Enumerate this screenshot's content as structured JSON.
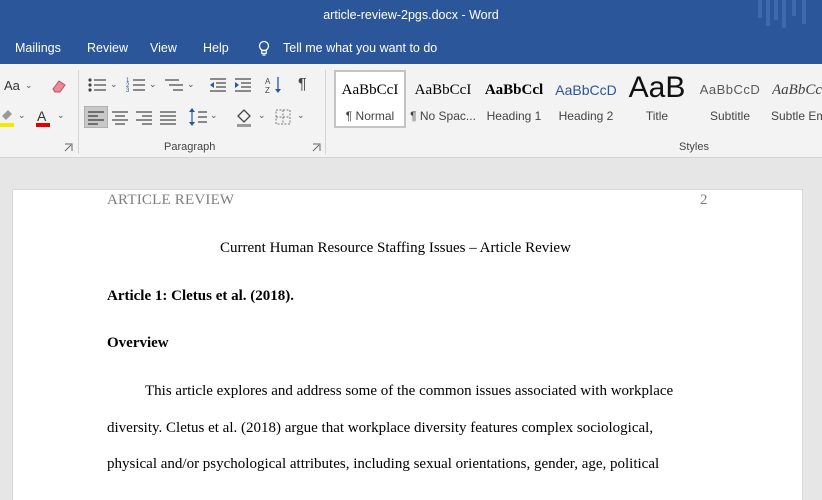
{
  "window": {
    "title": "article-review-2pgs.docx  -  Word"
  },
  "menu": {
    "items": [
      "Mailings",
      "Review",
      "View",
      "Help"
    ],
    "tell_me": "Tell me what you want to do"
  },
  "ribbon": {
    "font_group": {
      "change_case": "Aa"
    },
    "paragraph_group": {
      "label": "Paragraph"
    },
    "styles_group": {
      "label": "Styles",
      "styles": [
        {
          "sample": "AaBbCcI",
          "name": "¶ Normal"
        },
        {
          "sample": "AaBbCcI",
          "name": "¶ No Spac..."
        },
        {
          "sample": "AaBbCcl",
          "name": "Heading 1"
        },
        {
          "sample": "AaBbCcD",
          "name": "Heading 2"
        },
        {
          "sample": "AaB",
          "name": "Title"
        },
        {
          "sample": "AaBbCcD",
          "name": "Subtitle"
        },
        {
          "sample": "AaBbCc",
          "name": "Subtle Em"
        }
      ]
    }
  },
  "document": {
    "header_left": "ARTICLE REVIEW",
    "header_page": "2",
    "title": "Current Human Resource Staffing Issues – Article Review",
    "heading1": "Article 1: Cletus et al. (2018).",
    "heading2": "Overview",
    "body_lines": [
      "This article explores and address some of the common issues associated with workplace",
      "diversity. Cletus et al. (2018) argue that workplace diversity features complex sociological,",
      "physical and/or psychological attributes, including sexual orientations, gender, age, political"
    ]
  },
  "colors": {
    "brand": "#2b579a",
    "ribbon_bg": "#f3f3f3",
    "canvas_bg": "#e6e6e6"
  }
}
